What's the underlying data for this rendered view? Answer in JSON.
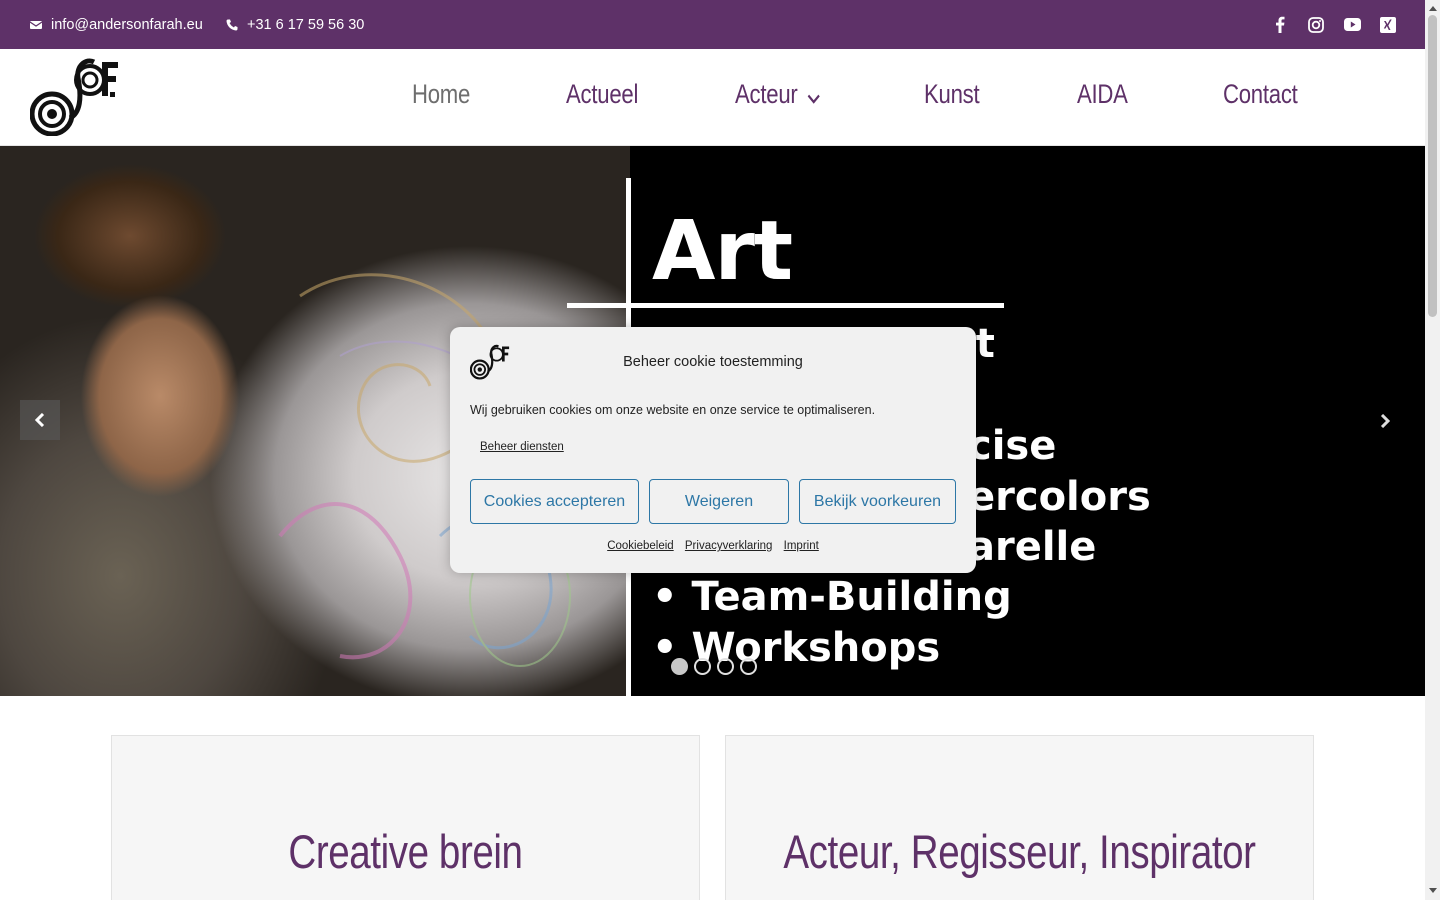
{
  "topbar": {
    "email": "info@andersonfarah.eu",
    "phone": "+31 6 17 59 56 30",
    "social": [
      "facebook-icon",
      "instagram-icon",
      "youtube-icon",
      "xing-icon"
    ],
    "background": "#5e3168"
  },
  "nav": {
    "items": [
      {
        "label": "Home",
        "active": true
      },
      {
        "label": "Actueel"
      },
      {
        "label": "Acteur",
        "has_dropdown": true
      },
      {
        "label": "Kunst"
      },
      {
        "label": "AIDA"
      },
      {
        "label": "Contact"
      }
    ]
  },
  "hero": {
    "title": "Art",
    "lines": [
      "st",
      "cise",
      "ercolors",
      "arelle",
      "• Team-Building",
      "• Workshops"
    ],
    "slide_count": 4,
    "active_slide": 1
  },
  "cookie": {
    "title": "Beheer cookie toestemming",
    "text": "Wij gebruiken cookies om onze website en onze service te optimaliseren.",
    "manage": "Beheer diensten",
    "accept": "Cookies accepteren",
    "deny": "Weigeren",
    "preferences": "Bekijk voorkeuren",
    "links": [
      "Cookiebeleid",
      "Privacyverklaring",
      "Imprint"
    ]
  },
  "cards": [
    {
      "title": "Creative brein"
    },
    {
      "title": "Acteur, Regisseur, Inspirator"
    }
  ],
  "colors": {
    "brand_purple": "#5e3168",
    "button_blue": "#2d77a6",
    "nav_active": "#6e6e6e"
  }
}
